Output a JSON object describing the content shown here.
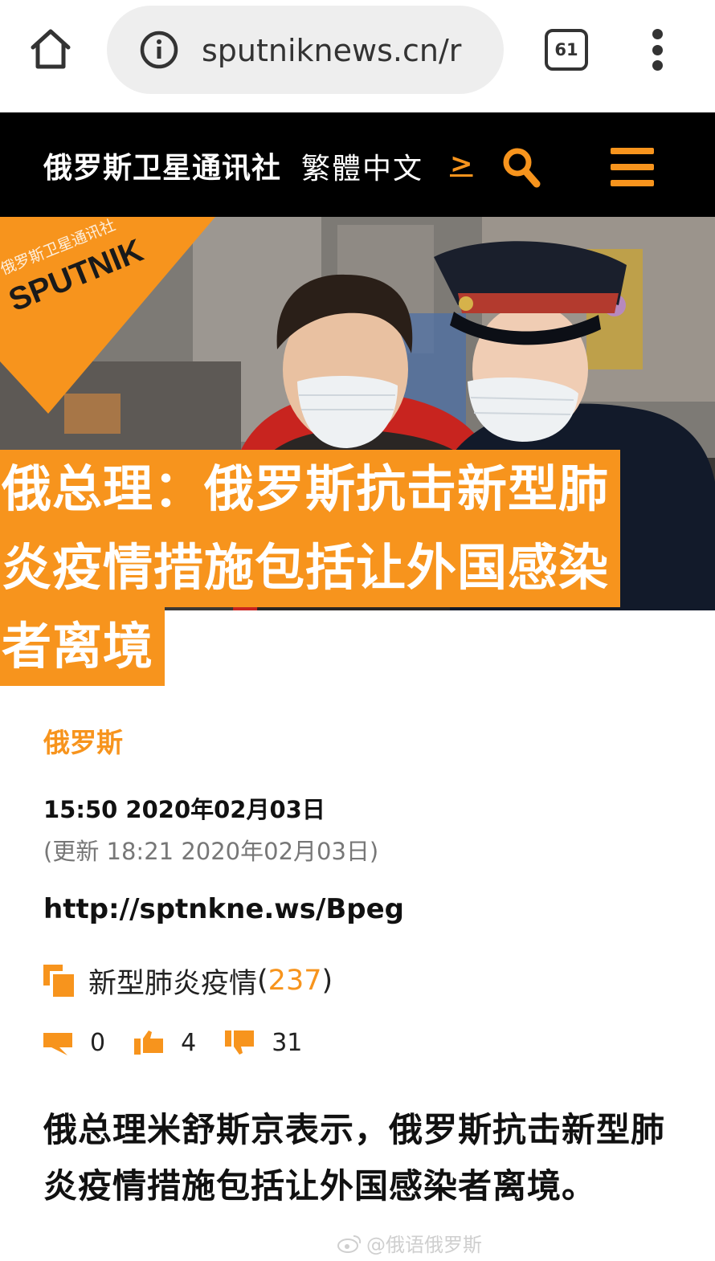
{
  "browser": {
    "url": "sputniknews.cn/r",
    "tab_count": "61"
  },
  "site": {
    "name": "俄罗斯卫星通讯社",
    "language_switch": "繁體中文",
    "language_arrow": ">",
    "accent_color": "#f7941d"
  },
  "hero": {
    "logo_text": "SPUTNIK",
    "logo_subtext": "俄罗斯卫星通讯社"
  },
  "article": {
    "headline_lines": [
      "俄总理：俄罗斯抗击新型肺",
      "炎疫情措施包括让外国感染",
      "者离境"
    ],
    "category": "俄罗斯",
    "published": "15:50 2020年02月03日",
    "updated": "(更新 18:21 2020年02月03日)",
    "short_link": "http://sptnkne.ws/Bpeg",
    "topic": {
      "label": "新型肺炎疫情",
      "open_paren": " (",
      "count": "237",
      "close_paren": ")"
    },
    "stats": {
      "comments": "0",
      "likes": "4",
      "dislikes": "31"
    },
    "lead": "俄总理米舒斯京表示，俄罗斯抗击新型肺炎疫情措施包括让外国感染者离境。"
  },
  "watermark": "@俄语俄罗斯"
}
